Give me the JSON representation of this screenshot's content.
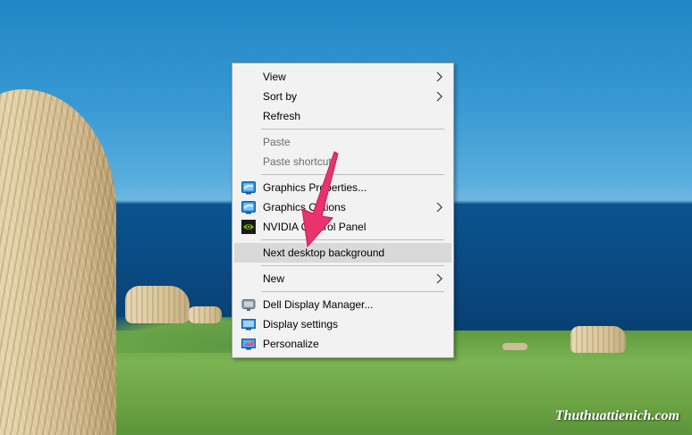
{
  "context_menu": {
    "items": [
      {
        "label": "View",
        "submenu": true,
        "enabled": true
      },
      {
        "label": "Sort by",
        "submenu": true,
        "enabled": true
      },
      {
        "label": "Refresh",
        "submenu": false,
        "enabled": true
      },
      {
        "label": "Paste",
        "submenu": false,
        "enabled": false
      },
      {
        "label": "Paste shortcut",
        "submenu": false,
        "enabled": false
      },
      {
        "label": "Graphics Properties...",
        "icon": "intel-graphics-icon",
        "enabled": true
      },
      {
        "label": "Graphics Options",
        "icon": "intel-graphics-icon",
        "submenu": true,
        "enabled": true
      },
      {
        "label": "NVIDIA Control Panel",
        "icon": "nvidia-icon",
        "enabled": true
      },
      {
        "label": "Next desktop background",
        "highlighted": true,
        "enabled": true
      },
      {
        "label": "New",
        "submenu": true,
        "enabled": true
      },
      {
        "label": "Dell Display Manager...",
        "icon": "monitor-icon",
        "enabled": true
      },
      {
        "label": "Display settings",
        "icon": "display-icon",
        "enabled": true
      },
      {
        "label": "Personalize",
        "icon": "personalize-icon",
        "enabled": true
      }
    ]
  },
  "annotation": {
    "arrow_color": "#e8336e"
  },
  "watermark": {
    "text": "Thuthuattienich.com"
  },
  "colors": {
    "menu_bg": "#f2f2f2",
    "hover_bg": "#d9d9d9",
    "disabled_text": "#6d6d6d"
  }
}
